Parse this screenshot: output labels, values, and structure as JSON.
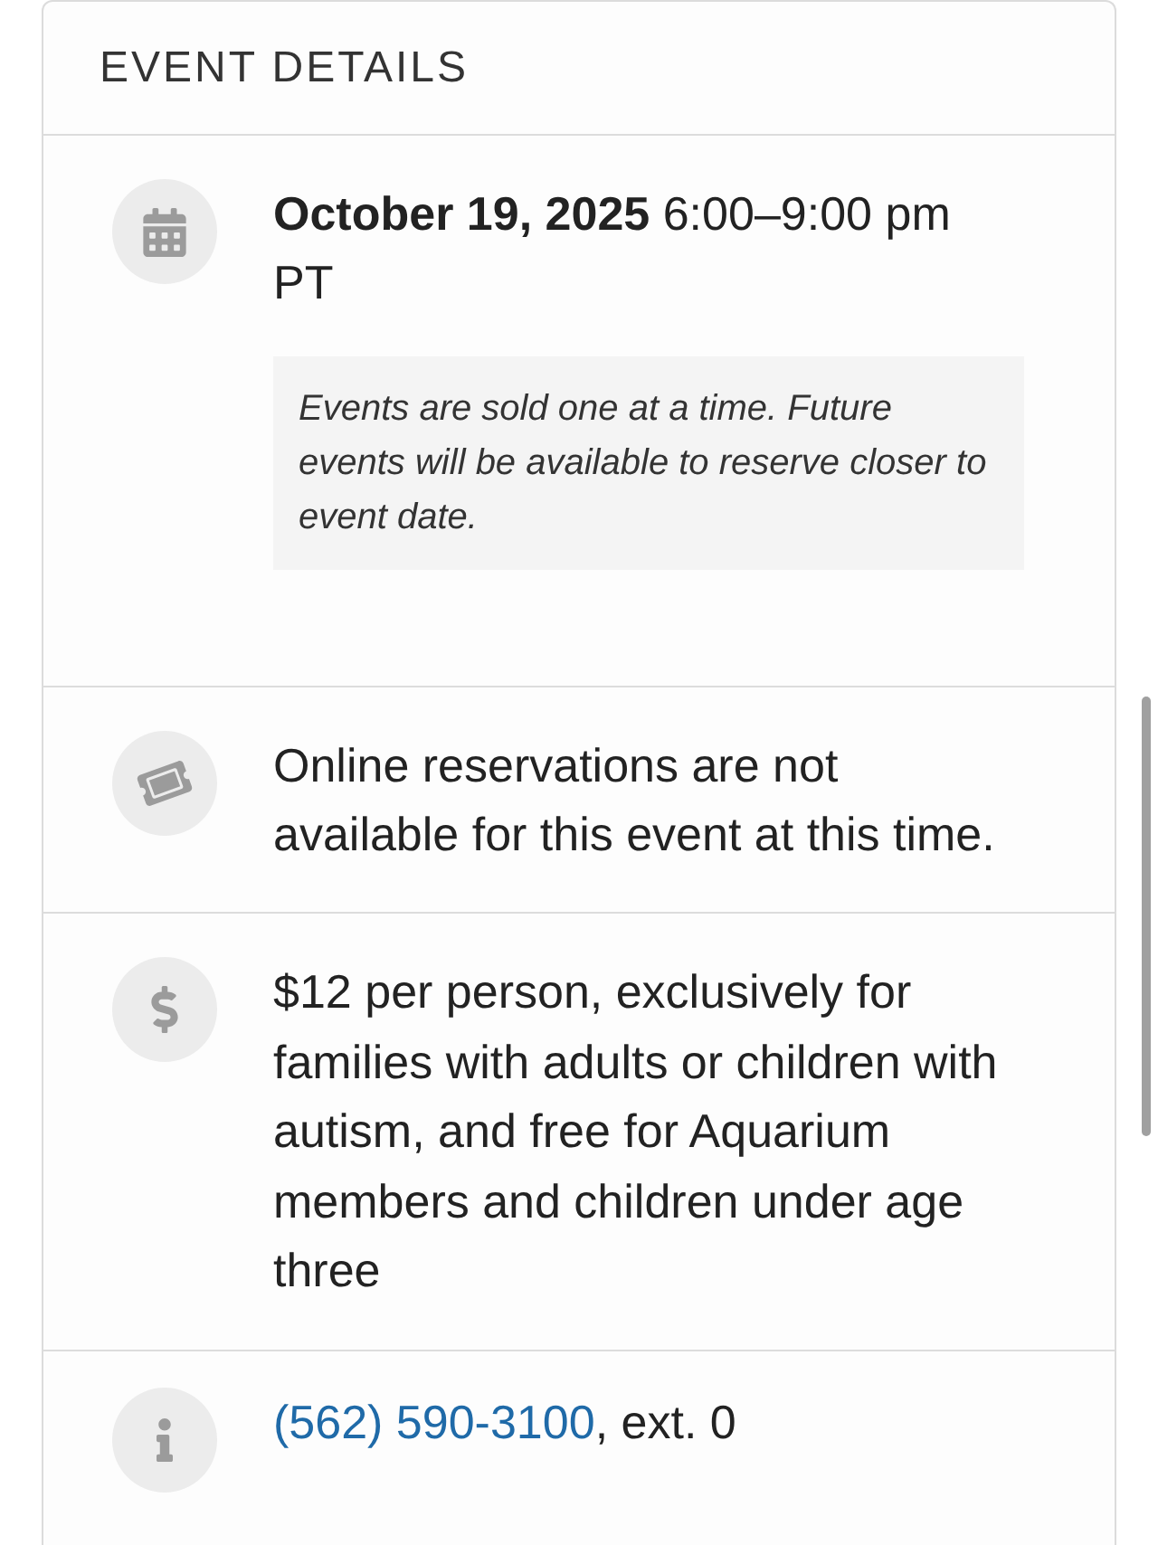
{
  "header": {
    "title": "EVENT DETAILS"
  },
  "sections": [
    {
      "kind": "date",
      "when": "**October 19, 2025** 6:00–9:00 pm PT",
      "note": "Events are sold one at a time. Future events will be available to reserve closer to event date."
    },
    {
      "kind": "reservations",
      "text": "Online reservations are not available for this event at this time."
    },
    {
      "kind": "price",
      "text": "$12 per person, exclusively for families with adults or children with autism, and free for Aquarium members and children under age three"
    },
    {
      "kind": "contact",
      "phone": "(562) 590-3100",
      "suffix": ", ext. 0"
    }
  ]
}
